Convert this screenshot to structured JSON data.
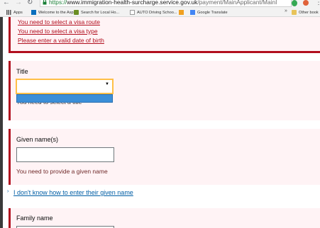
{
  "browser": {
    "url_scheme": "https://",
    "url_host": "www.immigration-health-surcharge.service.gov.uk",
    "url_path": "/payment/MainApplicant/MainI",
    "bookmarks": [
      {
        "label": "Apps",
        "icon": "apps-icon"
      },
      {
        "label": "Welcome to the Asp...",
        "icon": "site-icon"
      },
      {
        "label": "Search for Local Ho...",
        "icon": "site-icon"
      },
      {
        "label": "AUTO Driving Schoo...",
        "icon": "page-icon"
      },
      {
        "label": "",
        "icon": "ad-icon"
      },
      {
        "label": "Google Translate",
        "icon": "translate-icon"
      },
      {
        "label": "Other book",
        "icon": "folder-icon"
      }
    ],
    "more_bookmarks_label": "»"
  },
  "error_summary": {
    "links": [
      "You need to select a visa route",
      "You need to select a visa type",
      "Please enter a valid date of birth"
    ]
  },
  "title_field": {
    "label": "Title",
    "selected_value": "",
    "error": "You need to select a title"
  },
  "given_name_field": {
    "label": "Given name(s)",
    "value": "",
    "error": "You need to provide a given name"
  },
  "help_link": {
    "arrow": "›",
    "label": "I don't know how to enter their given name"
  },
  "family_name_field": {
    "label": "Family name",
    "value": ""
  },
  "colors": {
    "error_red": "#b10e1e",
    "error_bg": "#fff3f5",
    "link_blue": "#005ea5",
    "focus_yellow": "#ffbf47",
    "dropdown_highlight": "#3b8fd8"
  }
}
